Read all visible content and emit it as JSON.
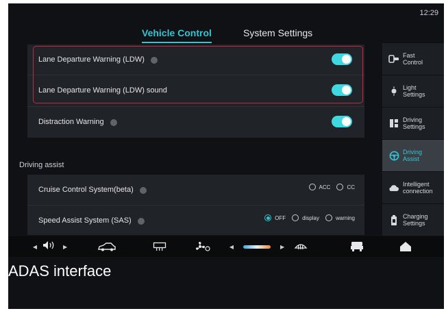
{
  "status": {
    "time": "12:29"
  },
  "tabs": [
    {
      "label": "Vehicle Control",
      "active": true
    },
    {
      "label": "System Settings",
      "active": false
    }
  ],
  "warnings": [
    {
      "label": "Lane Departure Warning (LDW)",
      "enabled": true
    },
    {
      "label": "Lane Departure Warning (LDW) sound",
      "enabled": true
    },
    {
      "label": "Distraction Warning",
      "enabled": true
    }
  ],
  "driving_assist": {
    "title": "Driving assist",
    "rows": [
      {
        "label": "Cruise Control System(beta)",
        "options": [
          {
            "label": "ACC",
            "checked": false
          },
          {
            "label": "CC",
            "checked": false
          }
        ]
      },
      {
        "label": "Speed Assist System (SAS)",
        "options": [
          {
            "label": "OFF",
            "checked": true
          },
          {
            "label": "display",
            "checked": false
          },
          {
            "label": "warning",
            "checked": false
          }
        ]
      }
    ]
  },
  "sidebar": {
    "items": [
      {
        "line1": "Fast",
        "line2": "Control",
        "icon": "fast-control-icon",
        "active": false
      },
      {
        "line1": "Light",
        "line2": "Settings",
        "icon": "light-icon",
        "active": false
      },
      {
        "line1": "Driving",
        "line2": "Settings",
        "icon": "driving-settings-icon",
        "active": false
      },
      {
        "line1": "Driving",
        "line2": "Assist",
        "icon": "steering-wheel-icon",
        "active": true
      },
      {
        "line1": "Intelligent",
        "line2": "connection",
        "icon": "cloud-icon",
        "active": false
      },
      {
        "line1": "Charging",
        "line2": "Settings",
        "icon": "battery-icon",
        "active": false
      }
    ]
  },
  "bottom_bar": {
    "icons": [
      "volume-icon",
      "car-icon",
      "rear-defrost-icon",
      "fan-icon",
      "temperature-slider",
      "front-defrost-icon",
      "seat-icon",
      "home-icon"
    ]
  },
  "caption": "ADAS interface",
  "colors": {
    "accent": "#33c4d6",
    "toggle_on": "#3fd8e0",
    "highlight": "#d0213f",
    "background": "#0f1115",
    "panel": "#202328"
  }
}
